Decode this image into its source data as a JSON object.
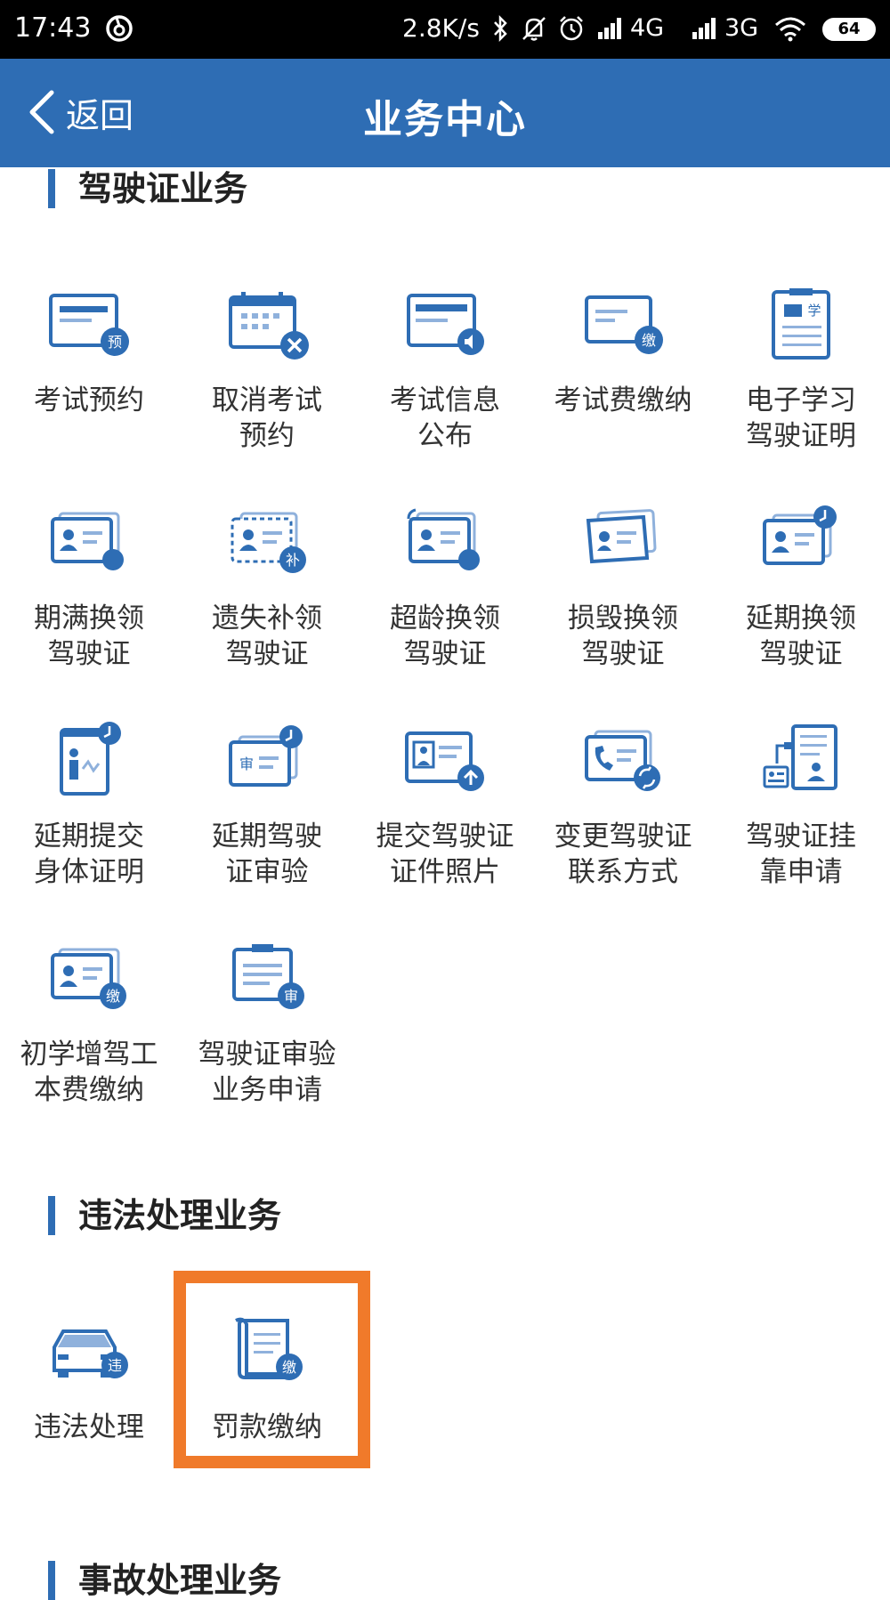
{
  "status_bar": {
    "time": "17:43",
    "net_speed": "2.8K/s",
    "network_1": "4G",
    "network_2": "3G",
    "battery": "64"
  },
  "header": {
    "back_label": "返回",
    "title": "业务中心"
  },
  "colors": {
    "primary": "#2e6db4",
    "highlight": "#f07a2a"
  },
  "sections": {
    "license": {
      "title": "驾驶证业务",
      "items": [
        {
          "label": "考试预约",
          "icon": "exam-reserve-icon"
        },
        {
          "label": "取消考试\n预约",
          "icon": "cancel-exam-icon"
        },
        {
          "label": "考试信息\n公布",
          "icon": "exam-info-icon"
        },
        {
          "label": "考试费缴纳",
          "icon": "exam-fee-icon"
        },
        {
          "label": "电子学习\n驾驶证明",
          "icon": "study-proof-icon"
        },
        {
          "label": "期满换领\n驾驶证",
          "icon": "expire-renew-icon"
        },
        {
          "label": "遗失补领\n驾驶证",
          "icon": "lost-replace-icon"
        },
        {
          "label": "超龄换领\n驾驶证",
          "icon": "overage-renew-icon"
        },
        {
          "label": "损毁换领\n驾驶证",
          "icon": "damaged-renew-icon"
        },
        {
          "label": "延期换领\n驾驶证",
          "icon": "delay-renew-icon"
        },
        {
          "label": "延期提交\n身体证明",
          "icon": "delay-health-icon"
        },
        {
          "label": "延期驾驶\n证审验",
          "icon": "delay-review-icon"
        },
        {
          "label": "提交驾驶证\n证件照片",
          "icon": "upload-photo-icon"
        },
        {
          "label": "变更驾驶证\n联系方式",
          "icon": "change-contact-icon"
        },
        {
          "label": "驾驶证挂\n靠申请",
          "icon": "affiliate-apply-icon"
        },
        {
          "label": "初学增驾工\n本费缴纳",
          "icon": "learner-fee-icon"
        },
        {
          "label": "驾驶证审验\n业务申请",
          "icon": "review-apply-icon"
        }
      ]
    },
    "violation": {
      "title": "违法处理业务",
      "items": [
        {
          "label": "违法处理",
          "icon": "violation-car-icon"
        },
        {
          "label": "罚款缴纳",
          "icon": "fine-pay-icon"
        }
      ]
    },
    "accident": {
      "title": "事故处理业务"
    }
  }
}
